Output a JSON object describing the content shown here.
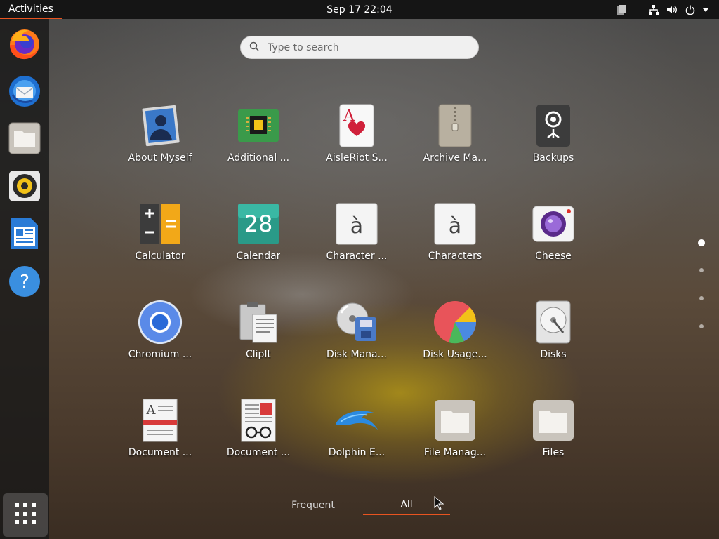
{
  "topbar": {
    "activities_label": "Activities",
    "clock": "Sep 17  22:04",
    "tray_icons": [
      "clipboard-icon",
      "network-icon",
      "volume-icon",
      "power-icon",
      "chevron-down-icon"
    ]
  },
  "dock": {
    "items": [
      "firefox-icon",
      "thunderbird-icon",
      "files-icon",
      "rhythmbox-icon",
      "writer-icon",
      "help-icon"
    ],
    "show_apps": "show-applications-icon"
  },
  "search": {
    "placeholder": "Type to search"
  },
  "apps": [
    {
      "label": "About Myself",
      "icon": "about-myself-icon"
    },
    {
      "label": "Additional ...",
      "icon": "additional-drivers-icon"
    },
    {
      "label": "AisleRiot S...",
      "icon": "aisleriot-icon"
    },
    {
      "label": "Archive Ma...",
      "icon": "archive-manager-icon"
    },
    {
      "label": "Backups",
      "icon": "backups-icon"
    },
    {
      "label": "Calculator",
      "icon": "calculator-icon"
    },
    {
      "label": "Calendar",
      "icon": "calendar-icon",
      "day": "28"
    },
    {
      "label": "Character ...",
      "icon": "character-map-icon",
      "glyph": "à"
    },
    {
      "label": "Characters",
      "icon": "characters-icon",
      "glyph": "à"
    },
    {
      "label": "Cheese",
      "icon": "cheese-icon"
    },
    {
      "label": "Chromium ...",
      "icon": "chromium-icon"
    },
    {
      "label": "ClipIt",
      "icon": "clipit-icon"
    },
    {
      "label": "Disk Mana...",
      "icon": "disk-manager-icon"
    },
    {
      "label": "Disk Usage...",
      "icon": "disk-usage-icon"
    },
    {
      "label": "Disks",
      "icon": "disks-icon"
    },
    {
      "label": "Document ...",
      "icon": "document-viewer-icon"
    },
    {
      "label": "Document ...",
      "icon": "document-scanner-icon"
    },
    {
      "label": "Dolphin E...",
      "icon": "dolphin-emulator-icon"
    },
    {
      "label": "File Manag...",
      "icon": "file-manager-icon"
    },
    {
      "label": "Files",
      "icon": "files-folder-icon"
    }
  ],
  "pages": {
    "count": 4,
    "current": 1
  },
  "tabs": {
    "frequent_label": "Frequent",
    "all_label": "All",
    "active": "all"
  },
  "colors": {
    "accent": "#e95420",
    "topbar": "#151515"
  }
}
